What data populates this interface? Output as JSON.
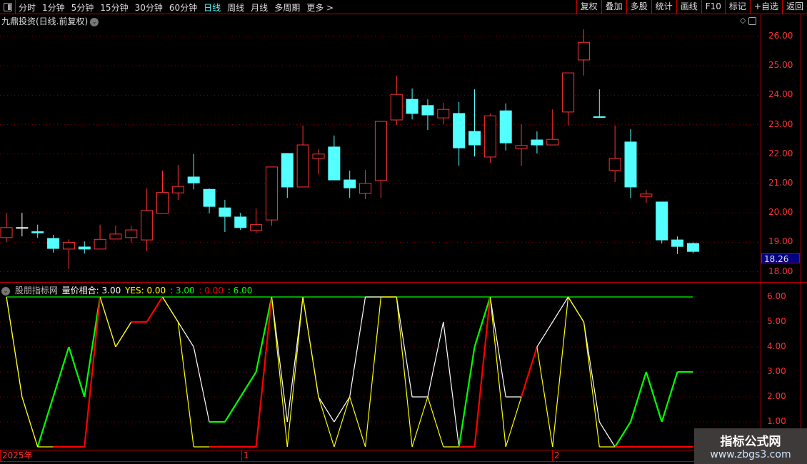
{
  "toolbar": {
    "periods": [
      "分时",
      "1分钟",
      "5分钟",
      "15分钟",
      "30分钟",
      "60分钟",
      "日线",
      "周线",
      "月线",
      "多周期",
      "更多 >"
    ],
    "active_period": "日线",
    "buttons": [
      "复权",
      "叠加",
      "多股",
      "统计",
      "画线",
      "F10",
      "标记",
      "+自选",
      "返回"
    ]
  },
  "stock": {
    "title": "九鼎投资(日线.前复权)"
  },
  "price_axis": {
    "labels": [
      "26.00",
      "25.00",
      "24.00",
      "23.00",
      "22.00",
      "21.00",
      "20.00",
      "19.00",
      "18.00"
    ],
    "last_price": "18.26"
  },
  "indicator": {
    "source": "股朋指标网",
    "name_value": "量价相合: 3.00",
    "yes_value": "YES: 0.00",
    "v3": ": 3.00",
    "v4": ": 0.00",
    "v5": ": 6.00",
    "axis_labels": [
      "6.00",
      "5.00",
      "4.00",
      "3.00",
      "2.00",
      "1.00"
    ]
  },
  "time_axis": {
    "labels": [
      "2025年",
      "1",
      "2"
    ]
  },
  "watermark": {
    "title": "指标公式网",
    "url": "www.zbgs3.com"
  },
  "colors": {
    "up": "#ff3232",
    "down": "#54ffff",
    "flat": "#ffffff",
    "grid": "#8a0000",
    "white_line": "#ffffff",
    "yellow_line": "#ffff00",
    "green_line": "#00ff00",
    "red_line": "#ff0000"
  },
  "chart_data": {
    "type": "candlestick",
    "ylim": [
      17.8,
      26.5
    ],
    "ohlc": [
      [
        19.16,
        20.0,
        19.0,
        19.5
      ],
      [
        19.5,
        20.0,
        19.2,
        19.5
      ],
      [
        19.36,
        19.6,
        19.15,
        19.32
      ],
      [
        19.13,
        19.25,
        18.65,
        18.79
      ],
      [
        18.77,
        19.1,
        18.09,
        19.0
      ],
      [
        18.84,
        19.03,
        18.62,
        18.77
      ],
      [
        18.77,
        19.6,
        18.77,
        19.1
      ],
      [
        19.11,
        19.57,
        19.11,
        19.28
      ],
      [
        19.16,
        19.55,
        18.99,
        19.42
      ],
      [
        19.08,
        20.83,
        18.7,
        20.08
      ],
      [
        19.98,
        21.44,
        19.98,
        20.7
      ],
      [
        20.68,
        21.63,
        20.44,
        20.9
      ],
      [
        21.22,
        22.0,
        20.8,
        21.02
      ],
      [
        20.8,
        20.83,
        19.98,
        20.22
      ],
      [
        20.17,
        20.44,
        19.35,
        19.88
      ],
      [
        19.86,
        20.0,
        19.42,
        19.5
      ],
      [
        19.4,
        20.15,
        19.3,
        19.6
      ],
      [
        19.76,
        21.56,
        19.57,
        21.56
      ],
      [
        22.02,
        22.02,
        20.51,
        20.88
      ],
      [
        20.88,
        22.97,
        20.88,
        22.31
      ],
      [
        21.85,
        22.17,
        21.31,
        22.0
      ],
      [
        22.24,
        22.63,
        21.12,
        21.12
      ],
      [
        21.12,
        21.44,
        20.51,
        20.85
      ],
      [
        20.66,
        21.46,
        20.47,
        21.0
      ],
      [
        21.1,
        23.11,
        20.51,
        23.11
      ],
      [
        23.16,
        24.67,
        22.99,
        24.03
      ],
      [
        23.86,
        24.23,
        23.18,
        23.38
      ],
      [
        23.65,
        23.86,
        22.82,
        23.33
      ],
      [
        23.23,
        23.74,
        23.01,
        23.52
      ],
      [
        23.38,
        23.77,
        21.6,
        22.21
      ],
      [
        22.77,
        24.2,
        21.92,
        22.31
      ],
      [
        21.9,
        23.38,
        21.7,
        23.3
      ],
      [
        23.47,
        23.72,
        22.12,
        22.38
      ],
      [
        22.19,
        23.01,
        21.6,
        22.29
      ],
      [
        22.48,
        22.77,
        22.02,
        22.31
      ],
      [
        22.31,
        23.52,
        22.31,
        22.5
      ],
      [
        23.43,
        24.76,
        22.97,
        24.76
      ],
      [
        25.2,
        26.24,
        24.67,
        25.8
      ],
      [
        23.27,
        24.2,
        23.25,
        23.25
      ],
      [
        21.44,
        22.97,
        21.05,
        21.85
      ],
      [
        22.41,
        22.85,
        20.51,
        20.88
      ],
      [
        20.56,
        20.78,
        20.34,
        20.64
      ],
      [
        20.37,
        20.37,
        18.96,
        19.08
      ],
      [
        19.08,
        19.2,
        18.6,
        18.86
      ],
      [
        18.96,
        19.0,
        18.62,
        18.69
      ]
    ],
    "indicator": {
      "ylim": [
        0,
        6
      ],
      "top_line": 6,
      "main": [
        6,
        2,
        0,
        2,
        4,
        2,
        6,
        4,
        5,
        5,
        6,
        5,
        4,
        1,
        1,
        2,
        3,
        6,
        1,
        6,
        2,
        1,
        2,
        6,
        6,
        6,
        2,
        2,
        5,
        0,
        4,
        6,
        2,
        2,
        4,
        5,
        6,
        5,
        1,
        0,
        1,
        3,
        1,
        3,
        3
      ],
      "main_colors": "wwggggwwwwwwwggggwwwwwwwwwwwwggwwwwwwwwgggggx",
      "yes": [
        6,
        2,
        0,
        0,
        0,
        0,
        6,
        4,
        5,
        5,
        6,
        5,
        0,
        0,
        0,
        0,
        0,
        6,
        0,
        6,
        2,
        0,
        2,
        0,
        6,
        6,
        0,
        2,
        0,
        0,
        0,
        6,
        0,
        2,
        4,
        0,
        6,
        5,
        0,
        0,
        0,
        0,
        0,
        0,
        0
      ],
      "yes_colors": "yyyrrryyrryyyrrrryyyyyyyyyyyyrryyryyyyyrrrrrx"
    }
  }
}
